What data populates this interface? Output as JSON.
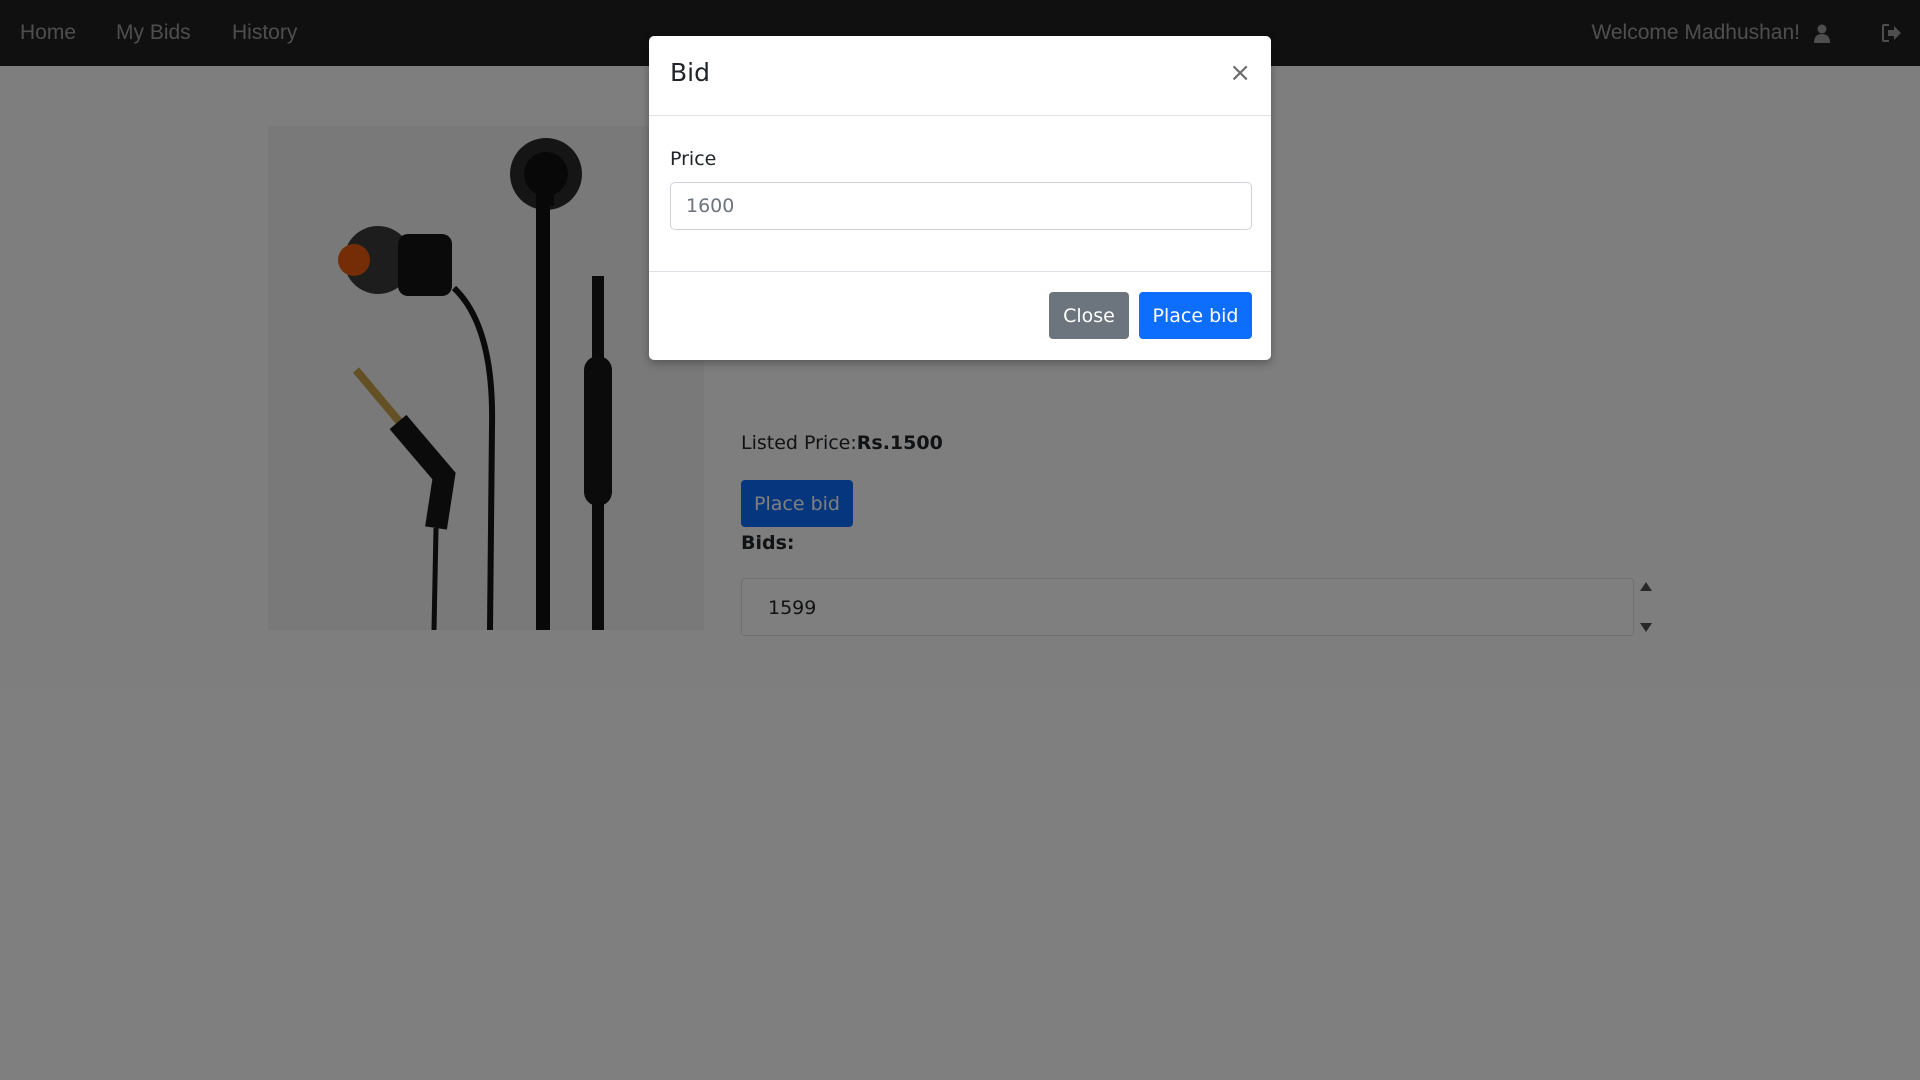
{
  "navbar": {
    "home": "Home",
    "my_bids": "My Bids",
    "history": "History",
    "welcome": "Welcome Madhushan!",
    "user_icon": "user-icon",
    "logout_icon": "logout-icon"
  },
  "product": {
    "listed_label": "Listed Price:",
    "listed_value": "Rs.1500",
    "place_bid": "Place bid",
    "bids_label": "Bids:",
    "bids": [
      "1599"
    ]
  },
  "modal": {
    "title": "Bid",
    "close_x": "×",
    "price_label": "Price",
    "price_value": "1600",
    "close_button": "Close",
    "place_bid_button": "Place bid"
  },
  "colors": {
    "navbar_bg": "#212121",
    "primary": "#0d6efd",
    "secondary": "#6c757d"
  }
}
